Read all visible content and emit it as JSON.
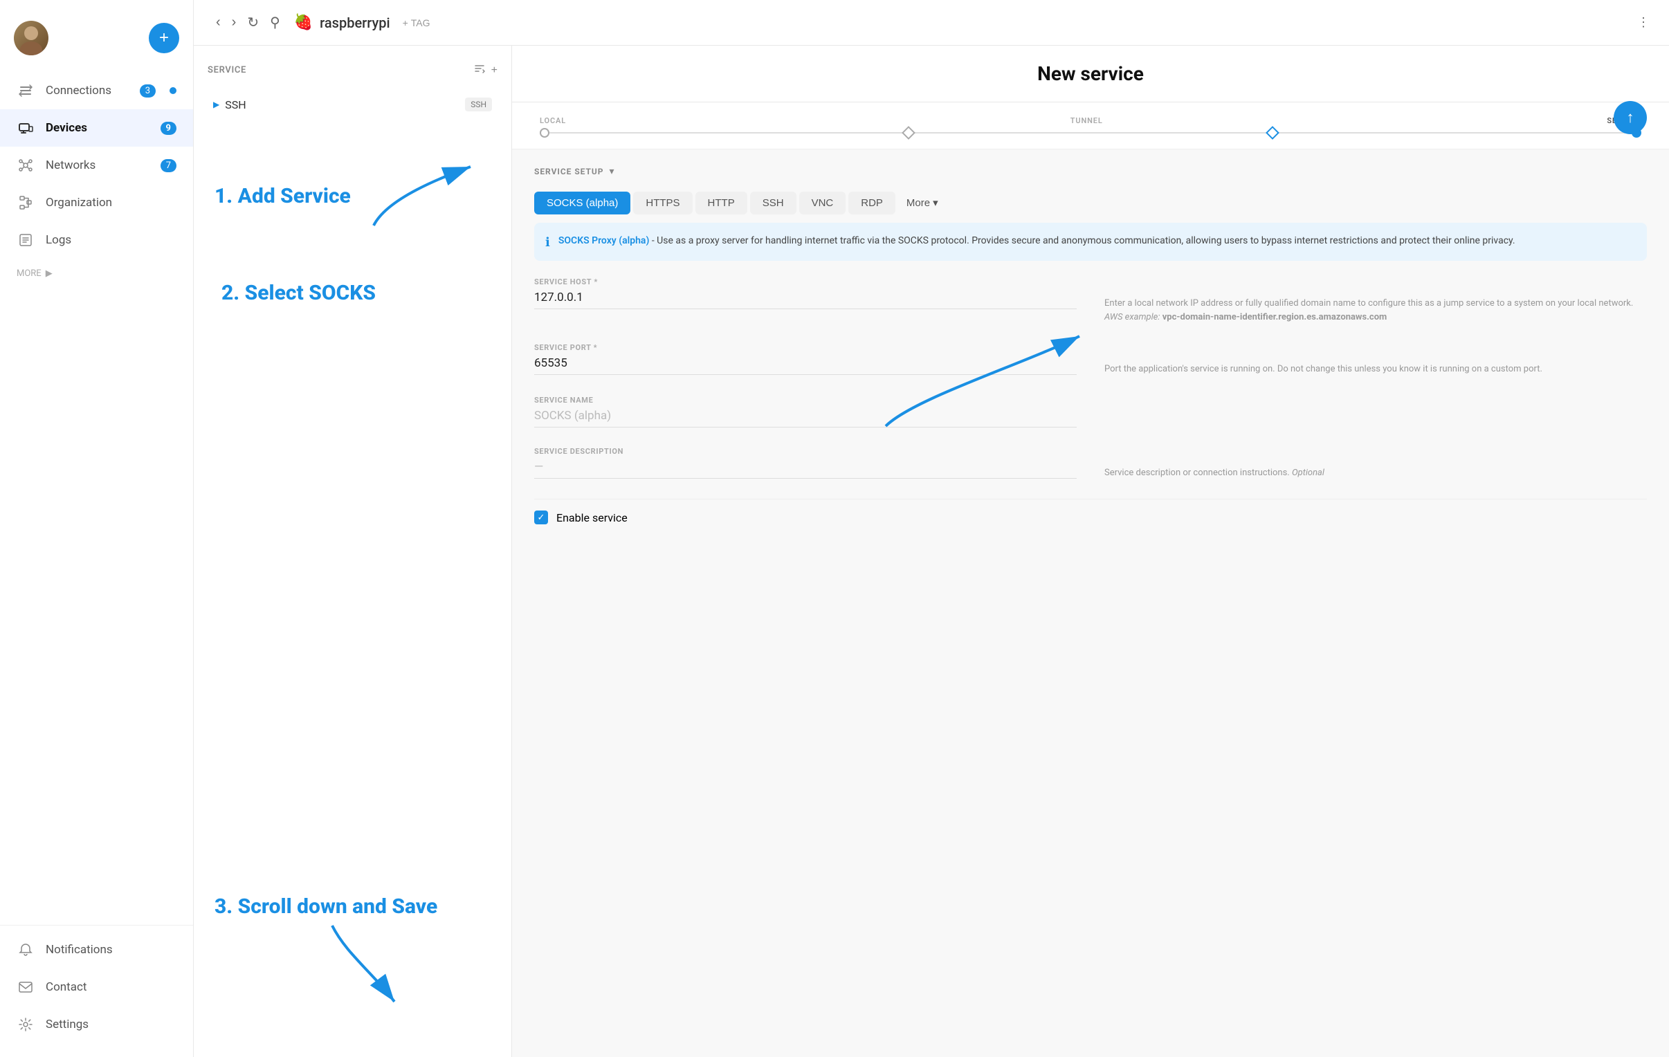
{
  "sidebar": {
    "add_button_label": "+",
    "nav_items": [
      {
        "id": "connections",
        "label": "Connections",
        "badge": "3",
        "has_dot": true,
        "icon": "arrows-icon"
      },
      {
        "id": "devices",
        "label": "Devices",
        "badge": "9",
        "active": true,
        "icon": "devices-icon"
      },
      {
        "id": "networks",
        "label": "Networks",
        "badge": "7",
        "icon": "networks-icon"
      },
      {
        "id": "organization",
        "label": "Organization",
        "icon": "org-icon"
      },
      {
        "id": "logs",
        "label": "Logs",
        "icon": "logs-icon"
      }
    ],
    "more_label": "MORE",
    "bottom_items": [
      {
        "id": "notifications",
        "label": "Notifications",
        "icon": "bell-icon"
      },
      {
        "id": "contact",
        "label": "Contact",
        "icon": "contact-icon"
      },
      {
        "id": "settings",
        "label": "Settings",
        "icon": "settings-icon"
      }
    ]
  },
  "topbar": {
    "device_name": "raspberrypi",
    "tag_label": "TAG"
  },
  "device_panel": {
    "section_title": "SERVICE",
    "services": [
      {
        "name": "SSH",
        "badge": "SSH"
      }
    ]
  },
  "new_service": {
    "title": "New service",
    "progress": {
      "labels": [
        "LOCAL",
        "TUNNEL",
        "SERVICE"
      ]
    },
    "setup_label": "SERVICE SETUP",
    "protocols": [
      "SOCKS (alpha)",
      "HTTPS",
      "HTTP",
      "SSH",
      "VNC",
      "RDP"
    ],
    "active_protocol": "SOCKS (alpha)",
    "more_label": "More",
    "info": {
      "title": "SOCKS Proxy (alpha)",
      "description": " - Use as a proxy server for handling internet traffic via the SOCKS protocol. Provides secure and anonymous communication, allowing users to bypass internet restrictions and protect their online privacy."
    },
    "fields": [
      {
        "label": "SERVICE HOST *",
        "value": "127.0.0.1",
        "help": "Enter a local network IP address or fully qualified domain name to configure this as a jump service to a system on your local network. AWS example: vpc-domain-name-identifier.region.es.amazonaws.com"
      },
      {
        "label": "SERVICE PORT *",
        "value": "65535",
        "help": "Port the application's service is running on. Do not change this unless you know it is running on a custom port."
      },
      {
        "label": "SERVICE NAME",
        "value": "SOCKS (alpha)",
        "is_placeholder": true,
        "help": ""
      },
      {
        "label": "SERVICE DESCRIPTION",
        "value": "—",
        "help": "Service description or connection instructions. Optional"
      }
    ],
    "enable_label": "Enable service"
  },
  "annotations": {
    "step1": "1. Add Service",
    "step2": "2. Select SOCKS",
    "step3": "3. Scroll down and Save"
  },
  "colors": {
    "blue": "#1a8fe3",
    "annotation_blue": "#1a8fe3"
  }
}
